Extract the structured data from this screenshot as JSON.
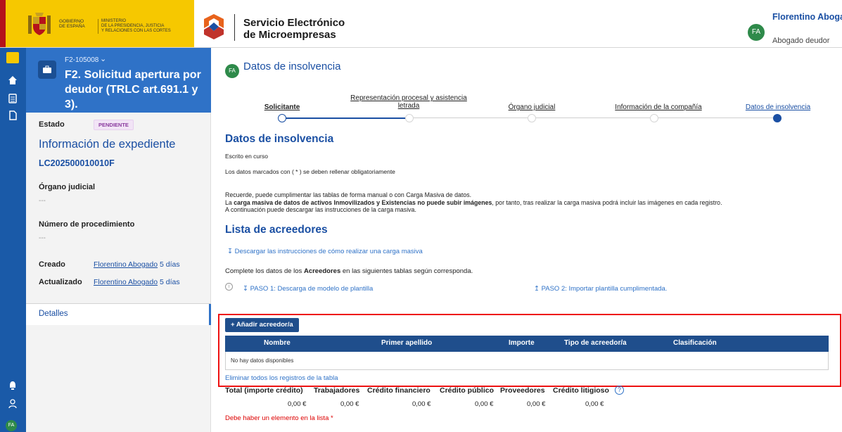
{
  "header": {
    "gov_line1": "GOBIERNO",
    "gov_line2": "DE ESPAÑA",
    "min_line1": "MINISTERIO",
    "min_line2": "DE LA PRESIDENCIA, JUSTICIA",
    "min_line3": "Y RELACIONES CON LAS CORTES",
    "app_title_1": "Servicio Electrónico",
    "app_title_2": "de Microempresas",
    "user_initials": "FA",
    "user_name": "Florentino Abogado",
    "user_role": "Abogado deudor"
  },
  "rail": {
    "icons": [
      "bell-icon",
      "home-icon",
      "grid-icon",
      "document-icon",
      "user-icon"
    ],
    "avatar": "FA"
  },
  "sidebar": {
    "case_code": "F2-105008",
    "case_title": "F2. Solicitud apertura por deudor (TRLC art.691.1 y 3).",
    "estado_label": "Estado",
    "estado_value": "PENDIENTE",
    "info_title": "Información de expediente",
    "exp_code": "LC202500010010F",
    "organo_label": "Órgano judicial",
    "organo_value": "---",
    "procedimiento_label": "Número de procedimiento",
    "procedimiento_value": "---",
    "creado_label": "Creado",
    "creado_user": "Florentino Abogado",
    "creado_time": "5 días",
    "actualizado_label": "Actualizado",
    "actualizado_user": "Florentino Abogado",
    "actualizado_time": "5 días",
    "tab_detalles": "Detalles"
  },
  "main": {
    "avatar": "FA",
    "title": "Datos de insolvencia",
    "steps": [
      {
        "label": "Solicitante",
        "state": "visited"
      },
      {
        "label": "Representación procesal y asistencia letrada",
        "state": "pending"
      },
      {
        "label": "Órgano judicial",
        "state": "pending"
      },
      {
        "label": "Información de la compañía",
        "state": "pending"
      },
      {
        "label": "Datos de insolvencia",
        "state": "current"
      }
    ],
    "section_title": "Datos de insolvencia",
    "escrito": "Escrito en curso",
    "obligatorio": "Los datos marcados con ( * ) se deben rellenar obligatoriamente",
    "note_line1": "Recuerde, puede cumplimentar las tablas de forma manual o con Carga Masiva de datos.",
    "note_line2_pre": "La ",
    "note_line2_bold": "carga masiva de datos de activos Inmovilizados y Existencias no puede subir imágenes",
    "note_line2_post": ", por tanto, tras realizar la carga masiva podrá incluir las imágenes en cada registro.",
    "note_line3": "A continuación puede descargar las instrucciones de la carga masiva.",
    "list_title": "Lista de acreedores",
    "download_instructions": "Descargar las instrucciones de cómo realizar una carga masiva",
    "complete_pre": "Complete los datos de los ",
    "complete_bold": "Acreedores",
    "complete_post": " en las siguientes tablas según corresponda.",
    "paso1": "PASO 1: Descarga de modelo de plantilla",
    "paso2": "PASO 2: Importar plantilla cumplimentada.",
    "add_button": "Añadir acreedor/a",
    "table_headers": [
      "Nombre",
      "Primer apellido",
      "Importe",
      "Tipo de acreedor/a",
      "Clasificación"
    ],
    "empty_text": "No hay datos disponibles",
    "delete_all": "Eliminar todos los registros de la tabla",
    "totals_headers": [
      "Total (importe crédito)",
      "Trabajadores",
      "Crédito financiero",
      "Crédito público",
      "Proveedores",
      "Crédito litigioso"
    ],
    "totals_values": [
      "0,00 €",
      "0,00 €",
      "0,00 €",
      "0,00 €",
      "0,00 €",
      "0,00 €"
    ],
    "error": "Debe haber un elemento en la lista *"
  },
  "colors": {
    "primary": "#1a4fa3",
    "rail": "#1a5aa8",
    "table_header": "#1f4e8c",
    "highlight": "#e11111",
    "error": "#dd0000",
    "gov_yellow": "#f6c800"
  }
}
